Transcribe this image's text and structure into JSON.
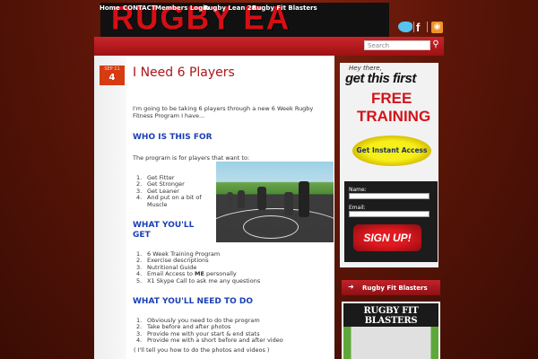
{
  "site": {
    "logo_text": "RUGBY EA",
    "social_icons": [
      "twitter-icon",
      "facebook-icon",
      "rss-icon"
    ]
  },
  "nav": {
    "items": [
      "Home",
      "CONTACT",
      "Members Login",
      "Rugby Lean 28",
      "Rugby Fit Blasters"
    ],
    "search_placeholder": "Search"
  },
  "post": {
    "date_month": "SEP 11",
    "date_day": "4",
    "title": "I Need 6 Players",
    "intro": "I'm going to be taking 6 players through a new 6 Week Rugby Fitness Program I have...",
    "heading_who": "WHO IS THIS FOR",
    "who_text": "The program is for players that want to:",
    "who_list": [
      "Get Fitter",
      "Get Stronger",
      "Get Leaner",
      "And put on a bit of",
      "Muscle"
    ],
    "heading_get_1": "WHAT YOU'LL",
    "heading_get_2": "GET",
    "get_list": [
      "6 Week Training Program",
      "Exercise descriptions",
      "Nutritional Guide",
      "Email Access to",
      "X1 Skype Call to ask me any questions"
    ],
    "get_email_bold": "ME",
    "get_email_after": "personally",
    "heading_need": "WHAT YOU'LL NEED TO DO",
    "need_list": [
      "Obviously you need to do the program",
      "Take before and after photos",
      "Provide me with your start & end stats",
      "Provide me with a short before and after video"
    ],
    "need_note": "( I'll tell you how to do the photos and videos )"
  },
  "sidebar": {
    "hey_there": "Hey there,",
    "get_this_first": "get this first",
    "free": "FREE",
    "training": "TRAINING",
    "instant_access": "Get Instant Access",
    "name_label": "Name:",
    "email_label": "Email:",
    "signup": "SIGN UP!",
    "widget_header": "Rugby Fit Blasters",
    "widget_title": "RUGBY FIT BLASTERS"
  },
  "colors": {
    "brand_red": "#c8262a",
    "heading_blue": "#1a3fb5",
    "title_red": "#b0141a",
    "date_orange": "#d63b12"
  }
}
